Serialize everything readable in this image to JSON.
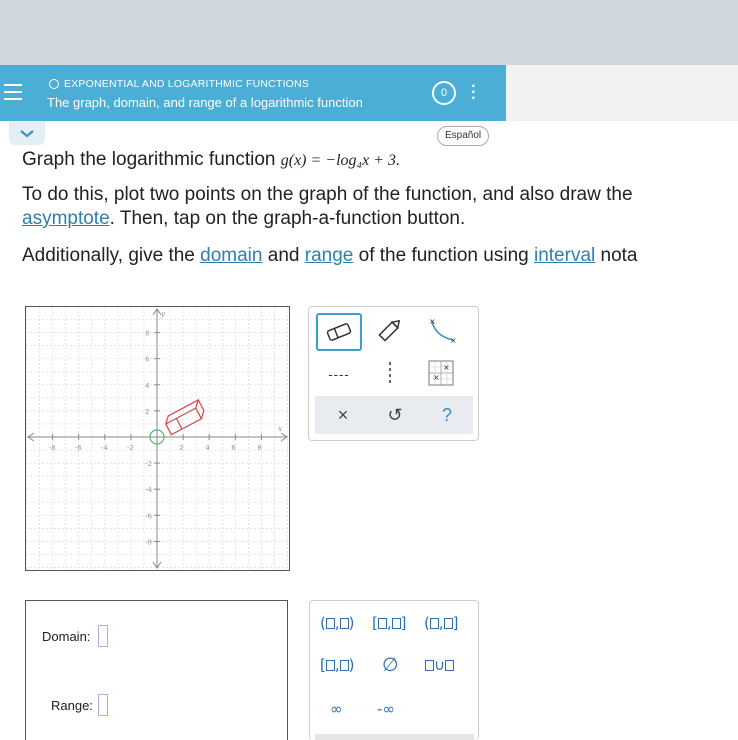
{
  "header": {
    "breadcrumb": "EXPONENTIAL AND LOGARITHMIC FUNCTIONS",
    "title": "The graph, domain, and range of a logarithmic function",
    "badge": "0"
  },
  "language_button": "Español",
  "prompt": {
    "line1_text": "Graph the logarithmic function ",
    "function_expr": "g(x) = −log₄x + 3.",
    "line2_text": "To do this, plot two points on the graph of the function, and also draw the",
    "line3_link": "asymptote",
    "line3_text": ". Then, tap on the graph-a-function button.",
    "line4_text1": "Additionally, give the ",
    "line4_link1": "domain",
    "line4_text2": " and ",
    "line4_link2": "range",
    "line4_text3": " of the function using ",
    "line4_link3": "interval",
    "line4_text4": " nota"
  },
  "graph": {
    "x_label": "x",
    "y_label": "y",
    "x_ticks": [
      "-8",
      "-6",
      "-4",
      "-2",
      "2",
      "4",
      "6",
      "8"
    ],
    "y_ticks": [
      "8",
      "6",
      "4",
      "2",
      "-2",
      "-4",
      "-6",
      "-8"
    ]
  },
  "tools": {
    "eraser": "eraser-icon",
    "pencil": "pencil-icon",
    "curve": "curve-tool-icon",
    "dashed": "----",
    "vertical_dashed": "vertical-dashed-line-icon",
    "graph_function": "graph-a-function-icon",
    "clear": "×",
    "undo": "↺",
    "help": "?"
  },
  "answers": {
    "domain_label": "Domain:",
    "range_label": "Range:"
  },
  "palette": {
    "infinity": "∞",
    "neg_infinity": "-∞",
    "empty_set": "∅"
  }
}
